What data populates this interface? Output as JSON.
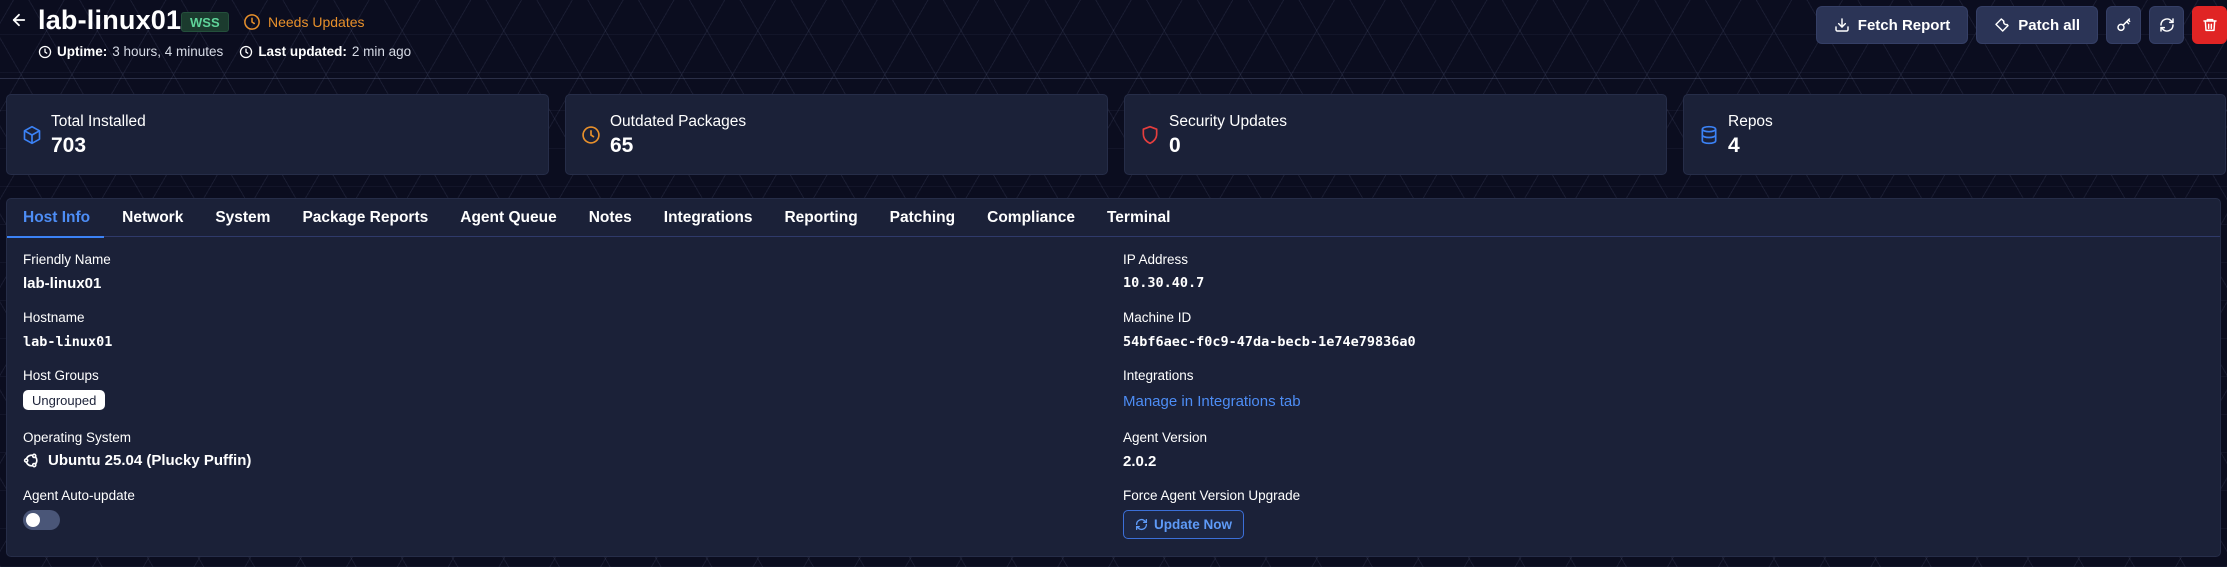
{
  "header": {
    "host_name": "lab-linux01",
    "badge": "WSS",
    "status": "Needs Updates",
    "uptime_label": "Uptime:",
    "uptime_value": "3 hours, 4 minutes",
    "updated_label": "Last updated:",
    "updated_value": "2 min ago"
  },
  "actions": {
    "fetch_report": "Fetch Report",
    "patch_all": "Patch all"
  },
  "stats": [
    {
      "label": "Total Installed",
      "value": "703",
      "icon": "cube-icon",
      "color": "#3b82f6"
    },
    {
      "label": "Outdated Packages",
      "value": "65",
      "icon": "clock-icon",
      "color": "#e8902b"
    },
    {
      "label": "Security Updates",
      "value": "0",
      "icon": "shield-icon",
      "color": "#e53e3e"
    },
    {
      "label": "Repos",
      "value": "4",
      "icon": "database-icon",
      "color": "#3b82f6"
    }
  ],
  "tabs": [
    "Host Info",
    "Network",
    "System",
    "Package Reports",
    "Agent Queue",
    "Notes",
    "Integrations",
    "Reporting",
    "Patching",
    "Compliance",
    "Terminal"
  ],
  "active_tab": "Host Info",
  "host_info": {
    "friendly_name_label": "Friendly Name",
    "friendly_name": "lab-linux01",
    "hostname_label": "Hostname",
    "hostname": "lab-linux01",
    "host_groups_label": "Host Groups",
    "host_group": "Ungrouped",
    "os_label": "Operating System",
    "os": "Ubuntu 25.04 (Plucky Puffin)",
    "auto_update_label": "Agent Auto-update",
    "auto_update_enabled": false,
    "ip_label": "IP Address",
    "ip": "10.30.40.7",
    "machine_id_label": "Machine ID",
    "machine_id": "54bf6aec-f0c9-47da-becb-1e74e79836a0",
    "integrations_label": "Integrations",
    "integrations_link": "Manage in Integrations tab",
    "agent_version_label": "Agent Version",
    "agent_version": "2.0.2",
    "force_upgrade_label": "Force Agent Version Upgrade",
    "update_now": "Update Now"
  },
  "colors": {
    "accent": "#3b82f6",
    "warning": "#e8902b",
    "danger": "#e02424",
    "badge_green": "#5fd49a"
  }
}
